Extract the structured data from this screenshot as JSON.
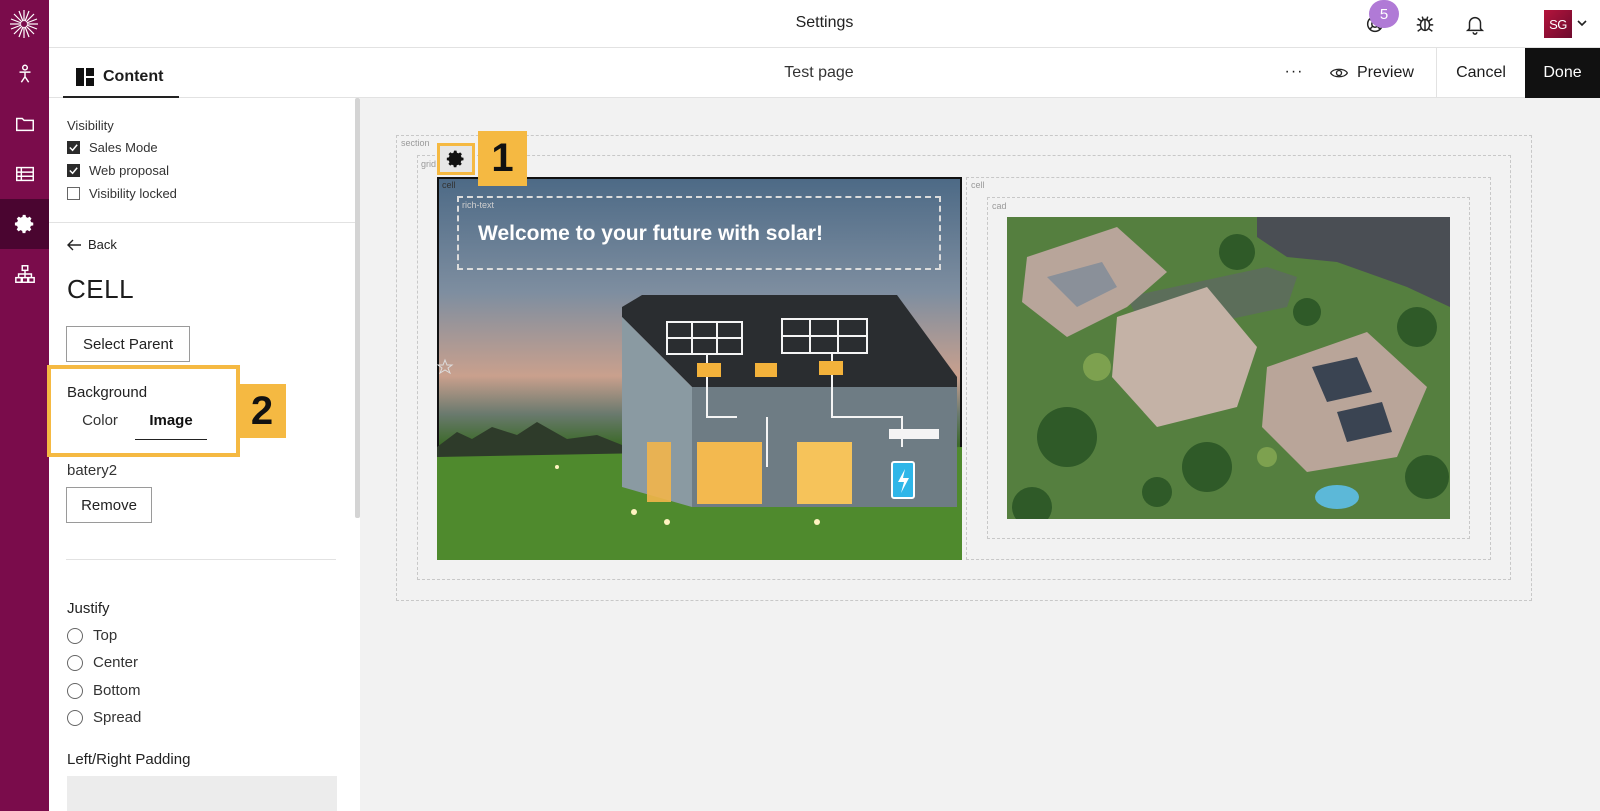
{
  "header": {
    "title": "Settings",
    "notification_count": "5",
    "avatar_initials": "SG"
  },
  "toolbar": {
    "tab_label": "Content",
    "page_name": "Test page",
    "more_label": "···",
    "preview_label": "Preview",
    "cancel_label": "Cancel",
    "done_label": "Done"
  },
  "panel": {
    "visibility_title": "Visibility",
    "visibility_options": [
      {
        "label": "Sales Mode",
        "checked": true
      },
      {
        "label": "Web proposal",
        "checked": true
      },
      {
        "label": "Visibility locked",
        "checked": false
      }
    ],
    "back_label": "Back",
    "title": "CELL",
    "select_parent_label": "Select Parent",
    "background_label": "Background",
    "background_tabs": [
      "Color",
      "Image"
    ],
    "background_active": "Image",
    "image_name": "batery2",
    "remove_label": "Remove",
    "justify_label": "Justify",
    "justify_options": [
      "Top",
      "Center",
      "Bottom",
      "Spread"
    ],
    "padding_label": "Left/Right Padding"
  },
  "callouts": [
    "1",
    "2"
  ],
  "canvas": {
    "section_label": "section",
    "grid_label": "grid",
    "cell_label_left": "cell",
    "cell_label_right": "cell",
    "richtext_label": "rich-text",
    "cad_label": "cad",
    "hero_title": "Welcome to your future with solar!"
  },
  "colors": {
    "rail": "#7a0c4b",
    "rail_active": "#4a0530",
    "highlight": "#f5b942",
    "done_bg": "#111111",
    "badge": "#b07ad6"
  }
}
